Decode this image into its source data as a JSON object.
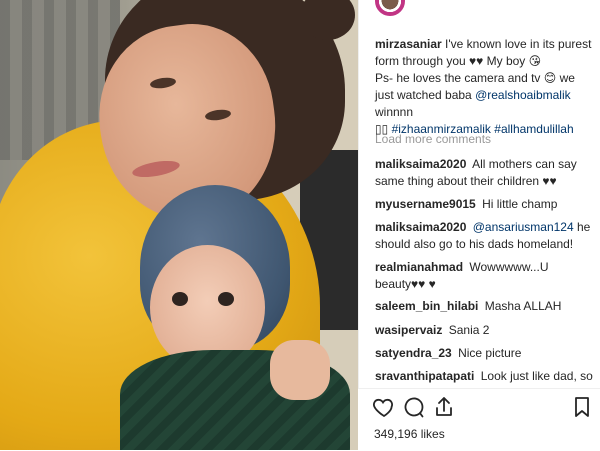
{
  "post": {
    "caption": {
      "username": "mirzasaniar",
      "text_line1": "I've known love in its purest form through you ♥♥ My boy 😘",
      "text_line2_prefix": "Ps- he loves the camera and tv 😊 we just watched baba ",
      "mention": "@realshoaibmalik",
      "text_after_mention": " winnnn",
      "emoji_box": "▯▯",
      "hashtags": "#izhaanmirzamalik #allhamdulillah"
    },
    "load_more_label": "Load more comments",
    "comments": [
      {
        "username": "maliksaima2020",
        "text": "All mothers can say same thing about their children ♥♥"
      },
      {
        "username": "myusername9015",
        "text": "Hi little champ"
      },
      {
        "username": "maliksaima2020",
        "mention": "@ansariusman124",
        "text": " he should also go to his dads homeland!"
      },
      {
        "username": "realmianahmad",
        "text": "Wowwwww...U beauty♥♥ ♥"
      },
      {
        "username": "saleem_bin_hilabi",
        "text": "Masha ALLAH"
      },
      {
        "username": "wasipervaiz",
        "text": "Sania 2"
      },
      {
        "username": "satyendra_23",
        "text": "Nice picture"
      },
      {
        "username": "sravanthipatapati",
        "text": "Look just like dad, so"
      }
    ],
    "likes": "349,196 likes"
  },
  "icons": [
    "heart-icon",
    "comment-icon",
    "share-icon",
    "bookmark-icon"
  ]
}
